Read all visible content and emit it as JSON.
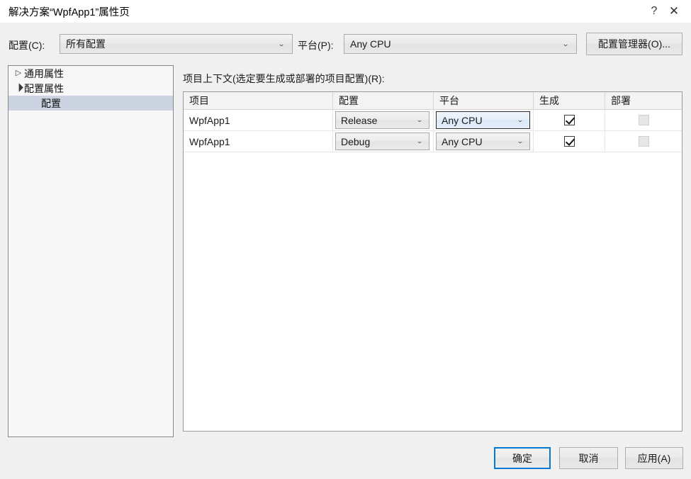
{
  "window": {
    "title": "解决方案“WpfApp1”属性页",
    "help_glyph": "?",
    "close_glyph": "✕"
  },
  "toolbar": {
    "config_label": "配置(C):",
    "config_value": "所有配置",
    "platform_label": "平台(P):",
    "platform_value": "Any CPU",
    "config_manager_button": "配置管理器(O)...",
    "arrow_glyph": "⌄"
  },
  "tree": {
    "items": [
      {
        "label": "通用属性",
        "level": 1,
        "state": "collapsed",
        "selected": false
      },
      {
        "label": "配置属性",
        "level": 1,
        "state": "expanded",
        "selected": false
      },
      {
        "label": "配置",
        "level": 2,
        "state": "leaf",
        "selected": true
      }
    ]
  },
  "main": {
    "section_label": "项目上下文(选定要生成或部署的项目配置)(R):",
    "columns": [
      "项目",
      "配置",
      "平台",
      "生成",
      "部署"
    ],
    "rows": [
      {
        "project": "WpfApp1",
        "configuration": "Release",
        "platform": "Any CPU",
        "build_checked": true,
        "deploy_checked": false,
        "deploy_disabled": true,
        "platform_focused": true
      },
      {
        "project": "WpfApp1",
        "configuration": "Debug",
        "platform": "Any CPU",
        "build_checked": true,
        "deploy_checked": false,
        "deploy_disabled": true,
        "platform_focused": false
      }
    ],
    "arrow_glyph": "⌄"
  },
  "footer": {
    "ok": "确定",
    "cancel": "取消",
    "apply": "应用(A)"
  },
  "colors": {
    "accent": "#0078d7",
    "dialog_bg": "#f0f0f0",
    "titlebar_bg": "#ffffff",
    "tree_selection": "#ccd3e1",
    "focus_border": "#2b2b2b"
  }
}
